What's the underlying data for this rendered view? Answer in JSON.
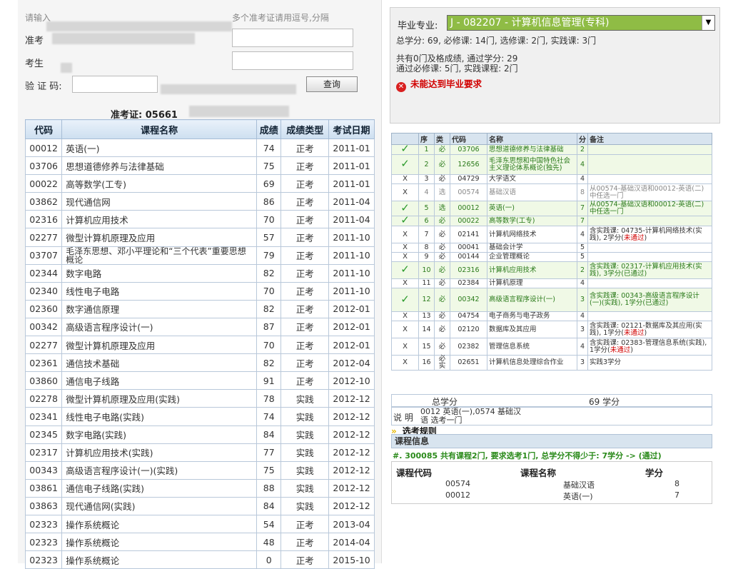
{
  "form": {
    "hint_left": "请输入",
    "hint_right": "多个准考证请用逗号,分隔",
    "ticket_label": "准考",
    "name_label": "考生",
    "captcha_label": "验 证 码:",
    "query_button": "查询",
    "ticket_title": "准考证: 05661"
  },
  "grades": {
    "headers": [
      "代码",
      "课程名称",
      "成绩",
      "成绩类型",
      "考试日期"
    ],
    "rows": [
      [
        "00012",
        "英语(一)",
        "74",
        "正考",
        "2011-01"
      ],
      [
        "03706",
        "思想道德修养与法律基础",
        "75",
        "正考",
        "2011-01"
      ],
      [
        "00022",
        "高等数学(工专)",
        "69",
        "正考",
        "2011-01"
      ],
      [
        "03862",
        "现代通信网",
        "86",
        "正考",
        "2011-04"
      ],
      [
        "02316",
        "计算机应用技术",
        "70",
        "正考",
        "2011-04"
      ],
      [
        "02277",
        "微型计算机原理及应用",
        "57",
        "正考",
        "2011-10"
      ],
      [
        "03707",
        "毛泽东思想、邓小平理论和“三个代表”重要思想概论",
        "79",
        "正考",
        "2011-10"
      ],
      [
        "02344",
        "数字电路",
        "82",
        "正考",
        "2011-10"
      ],
      [
        "02340",
        "线性电子电路",
        "70",
        "正考",
        "2011-10"
      ],
      [
        "02360",
        "数字通信原理",
        "82",
        "正考",
        "2012-01"
      ],
      [
        "00342",
        "高级语言程序设计(一)",
        "87",
        "正考",
        "2012-01"
      ],
      [
        "02277",
        "微型计算机原理及应用",
        "70",
        "正考",
        "2012-01"
      ],
      [
        "02361",
        "通信技术基础",
        "82",
        "正考",
        "2012-04"
      ],
      [
        "03860",
        "通信电子线路",
        "91",
        "正考",
        "2012-10"
      ],
      [
        "02278",
        "微型计算机原理及应用(实践)",
        "78",
        "实践",
        "2012-12"
      ],
      [
        "02341",
        "线性电子电路(实践)",
        "74",
        "实践",
        "2012-12"
      ],
      [
        "02345",
        "数字电路(实践)",
        "84",
        "实践",
        "2012-12"
      ],
      [
        "02317",
        "计算机应用技术(实践)",
        "77",
        "实践",
        "2012-12"
      ],
      [
        "00343",
        "高级语言程序设计(一)(实践)",
        "75",
        "实践",
        "2012-12"
      ],
      [
        "03861",
        "通信电子线路(实践)",
        "88",
        "实践",
        "2012-12"
      ],
      [
        "03863",
        "现代通信网(实践)",
        "84",
        "实践",
        "2012-12"
      ],
      [
        "02323",
        "操作系统概论",
        "54",
        "正考",
        "2013-04"
      ],
      [
        "02323",
        "操作系统概论",
        "48",
        "正考",
        "2014-04"
      ],
      [
        "02323",
        "操作系统概论",
        "0",
        "正考",
        "2015-10"
      ]
    ]
  },
  "major": {
    "label": "毕业专业:",
    "selected": "J - 082207 - 计算机信息管理(专科)",
    "summary1": "总学分: 69, 必修课: 14门, 选修课: 2门, 实践课: 3门",
    "summary2": "共有0门及格成绩, 通过学分: 29",
    "summary3": "通过必修课: 5门, 实践课程: 2门",
    "fail_text": "未能达到毕业要求",
    "fail_icon": "✕"
  },
  "courses": {
    "headers": [
      "",
      "序",
      "类",
      "代码",
      "名称",
      "分",
      "备注"
    ],
    "rows": [
      {
        "status": "✓",
        "cls": "pass",
        "no": "1",
        "type": "必",
        "code": "03706",
        "name": "思想道德修养与法律基础",
        "credit": "2",
        "note": ""
      },
      {
        "status": "✓",
        "cls": "pass",
        "no": "2",
        "type": "必",
        "code": "12656",
        "name": "毛泽东思想和中国特色社会主义理论体系概论(独先)",
        "credit": "4",
        "note": ""
      },
      {
        "status": "X",
        "cls": "",
        "no": "3",
        "type": "必",
        "code": "04729",
        "name": "大学语文",
        "credit": "4",
        "note": ""
      },
      {
        "status": "X",
        "cls": "gray",
        "no": "4",
        "type": "选",
        "code": "00574",
        "name": "基础汉语",
        "credit": "8",
        "note": "从00574-基础汉语和00012-英语(二)中任选一门"
      },
      {
        "status": "✓",
        "cls": "pass",
        "no": "5",
        "type": "选",
        "code": "00012",
        "name": "英语(一)",
        "credit": "7",
        "note": "从00574-基础汉语和00012-英语(二)中任选一门"
      },
      {
        "status": "✓",
        "cls": "pass",
        "no": "6",
        "type": "必",
        "code": "00022",
        "name": "高等数学(工专)",
        "credit": "7",
        "note": ""
      },
      {
        "status": "X",
        "cls": "",
        "no": "7",
        "type": "必",
        "code": "02141",
        "name": "计算机网络技术",
        "credit": "4",
        "note": "含实践课: 04735-计算机网络技术(实践), 2学分(",
        "note_red": "未通过",
        "note_end": ")"
      },
      {
        "status": "X",
        "cls": "",
        "no": "8",
        "type": "必",
        "code": "00041",
        "name": "基础会计学",
        "credit": "5",
        "note": ""
      },
      {
        "status": "X",
        "cls": "",
        "no": "9",
        "type": "必",
        "code": "00144",
        "name": "企业管理概论",
        "credit": "5",
        "note": ""
      },
      {
        "status": "✓",
        "cls": "pass",
        "no": "10",
        "type": "必",
        "code": "02316",
        "name": "计算机应用技术",
        "credit": "2",
        "note": "含实践课: 02317-计算机应用技术(实践), 3学分(已通过)"
      },
      {
        "status": "X",
        "cls": "",
        "no": "11",
        "type": "必",
        "code": "02384",
        "name": "计算机原理",
        "credit": "4",
        "note": ""
      },
      {
        "status": "✓",
        "cls": "pass",
        "no": "12",
        "type": "必",
        "code": "00342",
        "name": "高级语言程序设计(一)",
        "credit": "3",
        "note": "含实践课: 00343-高级语言程序设计(一)(实践), 1学分(已通过)"
      },
      {
        "status": "X",
        "cls": "",
        "no": "13",
        "type": "必",
        "code": "04754",
        "name": "电子商务与电子政务",
        "credit": "4",
        "note": ""
      },
      {
        "status": "X",
        "cls": "",
        "no": "14",
        "type": "必",
        "code": "02120",
        "name": "数据库及其应用",
        "credit": "3",
        "note": "含实践课: 02121-数据库及其应用(实践), 1学分(",
        "note_red": "未通过",
        "note_end": ")"
      },
      {
        "status": "X",
        "cls": "",
        "no": "15",
        "type": "必",
        "code": "02382",
        "name": "管理信息系统",
        "credit": "4",
        "note": "含实践课: 02383-管理信息系统(实践), 1学分(",
        "note_red": "未通过",
        "note_end": ")"
      },
      {
        "status": "X",
        "cls": "",
        "no": "16",
        "type": "必实",
        "code": "02651",
        "name": "计算机信息处理综合作业",
        "credit": "3",
        "note": "实践3学分"
      }
    ],
    "total_label": "总学分",
    "total_value": "69 学分",
    "explain_label": "说 明",
    "explain_text": "0012 英语(一),0574 基础汉语 选考一门"
  },
  "rules": {
    "arrow": "»",
    "title": "选考规则",
    "info_header": "课程信息",
    "rule_line": "#. 300085 共有课程2门, 要求选考1门, 总学分不得少于: 7学分 -> (通过)",
    "col_code": "课程代码",
    "col_name": "课程名称",
    "col_credit": "学分",
    "rows": [
      {
        "code": "00574",
        "name": "基础汉语",
        "credit": "8"
      },
      {
        "code": "00012",
        "name": "英语(一)",
        "credit": "7"
      }
    ]
  }
}
